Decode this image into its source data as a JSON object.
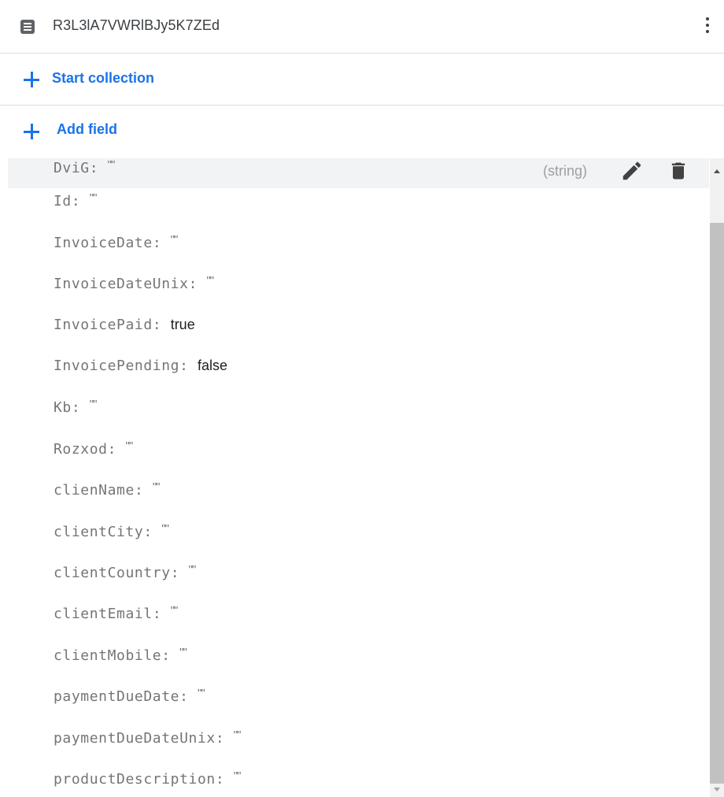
{
  "document": {
    "id": "R3L3lA7VWRlBJy5K7ZEd",
    "menu_icon": "more-vert-icon"
  },
  "actions": {
    "start_collection": "Start collection",
    "add_field": "Add field"
  },
  "hovered_field": {
    "type": "(string)",
    "edit_icon": "pencil-icon",
    "delete_icon": "trash-icon"
  },
  "fields": [
    {
      "key": "DviG",
      "value": "\"\"",
      "empty": true
    },
    {
      "key": "Id",
      "value": "\"\"",
      "empty": true
    },
    {
      "key": "InvoiceDate",
      "value": "\"\"",
      "empty": true
    },
    {
      "key": "InvoiceDateUnix",
      "value": "\"\"",
      "empty": true
    },
    {
      "key": "InvoicePaid",
      "value": "true",
      "empty": false
    },
    {
      "key": "InvoicePending",
      "value": "false",
      "empty": false
    },
    {
      "key": "Kb",
      "value": "\"\"",
      "empty": true
    },
    {
      "key": "Rozxod",
      "value": "\"\"",
      "empty": true
    },
    {
      "key": "clienName",
      "value": "\"\"",
      "empty": true
    },
    {
      "key": "clientCity",
      "value": "\"\"",
      "empty": true
    },
    {
      "key": "clientCountry",
      "value": "\"\"",
      "empty": true
    },
    {
      "key": "clientEmail",
      "value": "\"\"",
      "empty": true
    },
    {
      "key": "clientMobile",
      "value": "\"\"",
      "empty": true
    },
    {
      "key": "paymentDueDate",
      "value": "\"\"",
      "empty": true
    },
    {
      "key": "paymentDueDateUnix",
      "value": "\"\"",
      "empty": true
    },
    {
      "key": "productDescription",
      "value": "\"\"",
      "empty": true
    }
  ],
  "colors": {
    "accent": "#1a73e8",
    "key_text": "#757575",
    "value_text": "#212121",
    "hover_row": "#f1f3f4"
  }
}
